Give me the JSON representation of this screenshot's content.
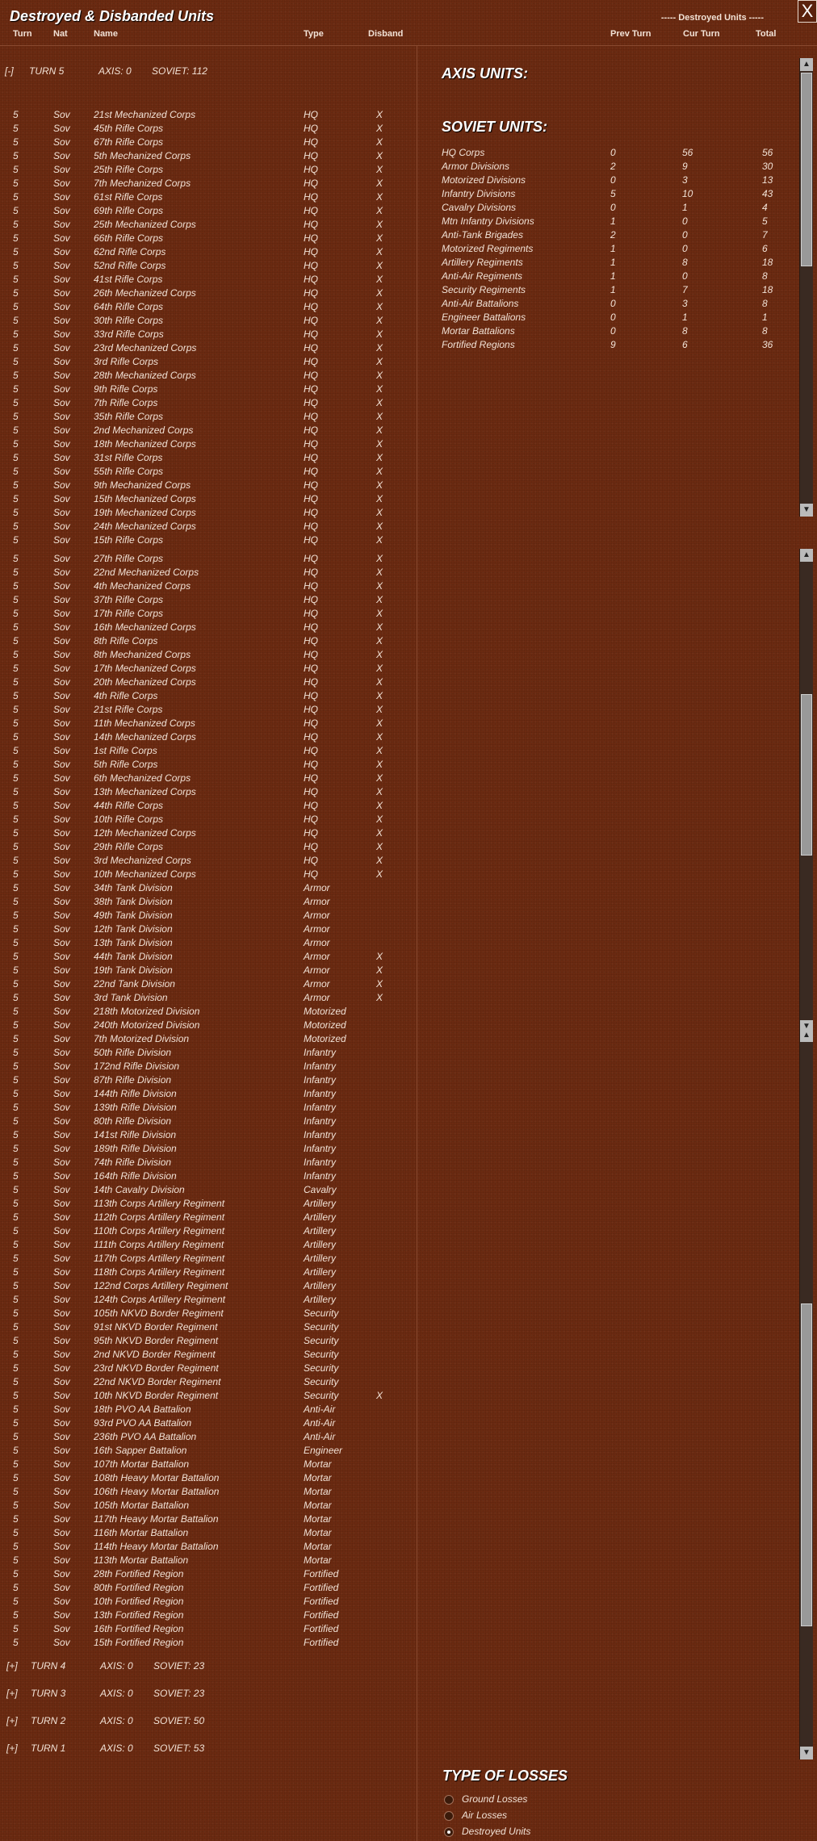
{
  "window": {
    "title": "Destroyed & Disbanded Units",
    "close": "X"
  },
  "headers": {
    "turn": "Turn",
    "nat": "Nat",
    "name": "Name",
    "type": "Type",
    "disband": "Disband",
    "destroyed_group": "----- Destroyed Units -----",
    "prev_turn": "Prev Turn",
    "cur_turn": "Cur Turn",
    "total": "Total"
  },
  "expanded_turn": {
    "toggle": "[-]",
    "label": "TURN 5",
    "axis": "AXIS: 0",
    "soviet": "SOVIET: 112"
  },
  "units": [
    [
      "5",
      "Sov",
      "21st Mechanized Corps",
      "HQ",
      "X"
    ],
    [
      "5",
      "Sov",
      "45th Rifle Corps",
      "HQ",
      "X"
    ],
    [
      "5",
      "Sov",
      "67th Rifle Corps",
      "HQ",
      "X"
    ],
    [
      "5",
      "Sov",
      "5th Mechanized Corps",
      "HQ",
      "X"
    ],
    [
      "5",
      "Sov",
      "25th Rifle Corps",
      "HQ",
      "X"
    ],
    [
      "5",
      "Sov",
      "7th Mechanized Corps",
      "HQ",
      "X"
    ],
    [
      "5",
      "Sov",
      "61st Rifle Corps",
      "HQ",
      "X"
    ],
    [
      "5",
      "Sov",
      "69th Rifle Corps",
      "HQ",
      "X"
    ],
    [
      "5",
      "Sov",
      "25th Mechanized Corps",
      "HQ",
      "X"
    ],
    [
      "5",
      "Sov",
      "66th Rifle Corps",
      "HQ",
      "X"
    ],
    [
      "5",
      "Sov",
      "62nd Rifle Corps",
      "HQ",
      "X"
    ],
    [
      "5",
      "Sov",
      "52nd Rifle Corps",
      "HQ",
      "X"
    ],
    [
      "5",
      "Sov",
      "41st Rifle Corps",
      "HQ",
      "X"
    ],
    [
      "5",
      "Sov",
      "26th Mechanized Corps",
      "HQ",
      "X"
    ],
    [
      "5",
      "Sov",
      "64th Rifle Corps",
      "HQ",
      "X"
    ],
    [
      "5",
      "Sov",
      "30th Rifle Corps",
      "HQ",
      "X"
    ],
    [
      "5",
      "Sov",
      "33rd Rifle Corps",
      "HQ",
      "X"
    ],
    [
      "5",
      "Sov",
      "23rd Mechanized Corps",
      "HQ",
      "X"
    ],
    [
      "5",
      "Sov",
      "3rd Rifle Corps",
      "HQ",
      "X"
    ],
    [
      "5",
      "Sov",
      "28th Mechanized Corps",
      "HQ",
      "X"
    ],
    [
      "5",
      "Sov",
      "9th Rifle Corps",
      "HQ",
      "X"
    ],
    [
      "5",
      "Sov",
      "7th Rifle Corps",
      "HQ",
      "X"
    ],
    [
      "5",
      "Sov",
      "35th Rifle Corps",
      "HQ",
      "X"
    ],
    [
      "5",
      "Sov",
      "2nd Mechanized Corps",
      "HQ",
      "X"
    ],
    [
      "5",
      "Sov",
      "18th Mechanized Corps",
      "HQ",
      "X"
    ],
    [
      "5",
      "Sov",
      "31st Rifle Corps",
      "HQ",
      "X"
    ],
    [
      "5",
      "Sov",
      "55th Rifle Corps",
      "HQ",
      "X"
    ],
    [
      "5",
      "Sov",
      "9th Mechanized Corps",
      "HQ",
      "X"
    ],
    [
      "5",
      "Sov",
      "15th Mechanized Corps",
      "HQ",
      "X"
    ],
    [
      "5",
      "Sov",
      "19th Mechanized Corps",
      "HQ",
      "X"
    ],
    [
      "5",
      "Sov",
      "24th Mechanized Corps",
      "HQ",
      "X"
    ],
    [
      "5",
      "Sov",
      "15th Rifle Corps",
      "HQ",
      "X"
    ],
    [
      "5",
      "Sov",
      "27th Rifle Corps",
      "HQ",
      "X"
    ],
    [
      "5",
      "Sov",
      "22nd Mechanized Corps",
      "HQ",
      "X"
    ],
    [
      "5",
      "Sov",
      "4th Mechanized Corps",
      "HQ",
      "X"
    ],
    [
      "5",
      "Sov",
      "37th Rifle Corps",
      "HQ",
      "X"
    ],
    [
      "5",
      "Sov",
      "17th Rifle Corps",
      "HQ",
      "X"
    ],
    [
      "5",
      "Sov",
      "16th Mechanized Corps",
      "HQ",
      "X"
    ],
    [
      "5",
      "Sov",
      "8th Rifle Corps",
      "HQ",
      "X"
    ],
    [
      "5",
      "Sov",
      "8th Mechanized Corps",
      "HQ",
      "X"
    ],
    [
      "5",
      "Sov",
      "17th Mechanized Corps",
      "HQ",
      "X"
    ],
    [
      "5",
      "Sov",
      "20th Mechanized Corps",
      "HQ",
      "X"
    ],
    [
      "5",
      "Sov",
      "4th Rifle Corps",
      "HQ",
      "X"
    ],
    [
      "5",
      "Sov",
      "21st Rifle Corps",
      "HQ",
      "X"
    ],
    [
      "5",
      "Sov",
      "11th Mechanized Corps",
      "HQ",
      "X"
    ],
    [
      "5",
      "Sov",
      "14th Mechanized Corps",
      "HQ",
      "X"
    ],
    [
      "5",
      "Sov",
      "1st Rifle Corps",
      "HQ",
      "X"
    ],
    [
      "5",
      "Sov",
      "5th Rifle Corps",
      "HQ",
      "X"
    ],
    [
      "5",
      "Sov",
      "6th Mechanized Corps",
      "HQ",
      "X"
    ],
    [
      "5",
      "Sov",
      "13th Mechanized Corps",
      "HQ",
      "X"
    ],
    [
      "5",
      "Sov",
      "44th Rifle Corps",
      "HQ",
      "X"
    ],
    [
      "5",
      "Sov",
      "10th Rifle Corps",
      "HQ",
      "X"
    ],
    [
      "5",
      "Sov",
      "12th Mechanized Corps",
      "HQ",
      "X"
    ],
    [
      "5",
      "Sov",
      "29th Rifle Corps",
      "HQ",
      "X"
    ],
    [
      "5",
      "Sov",
      "3rd Mechanized Corps",
      "HQ",
      "X"
    ],
    [
      "5",
      "Sov",
      "10th Mechanized Corps",
      "HQ",
      "X"
    ],
    [
      "5",
      "Sov",
      "34th Tank Division",
      "Armor",
      ""
    ],
    [
      "5",
      "Sov",
      "38th Tank Division",
      "Armor",
      ""
    ],
    [
      "5",
      "Sov",
      "49th Tank Division",
      "Armor",
      ""
    ],
    [
      "5",
      "Sov",
      "12th Tank Division",
      "Armor",
      ""
    ],
    [
      "5",
      "Sov",
      "13th Tank Division",
      "Armor",
      ""
    ],
    [
      "5",
      "Sov",
      "44th Tank Division",
      "Armor",
      "X"
    ],
    [
      "5",
      "Sov",
      "19th Tank Division",
      "Armor",
      "X"
    ],
    [
      "5",
      "Sov",
      "22nd Tank Division",
      "Armor",
      "X"
    ],
    [
      "5",
      "Sov",
      "3rd Tank Division",
      "Armor",
      "X"
    ],
    [
      "5",
      "Sov",
      "218th Motorized Division",
      "Motorized",
      ""
    ],
    [
      "5",
      "Sov",
      "240th Motorized Division",
      "Motorized",
      ""
    ],
    [
      "5",
      "Sov",
      "7th Motorized Division",
      "Motorized",
      ""
    ],
    [
      "5",
      "Sov",
      "50th Rifle Division",
      "Infantry",
      ""
    ],
    [
      "5",
      "Sov",
      "172nd Rifle Division",
      "Infantry",
      ""
    ],
    [
      "5",
      "Sov",
      "87th Rifle Division",
      "Infantry",
      ""
    ],
    [
      "5",
      "Sov",
      "144th Rifle Division",
      "Infantry",
      ""
    ],
    [
      "5",
      "Sov",
      "139th Rifle Division",
      "Infantry",
      ""
    ],
    [
      "5",
      "Sov",
      "80th Rifle Division",
      "Infantry",
      ""
    ],
    [
      "5",
      "Sov",
      "141st Rifle Division",
      "Infantry",
      ""
    ],
    [
      "5",
      "Sov",
      "189th Rifle Division",
      "Infantry",
      ""
    ],
    [
      "5",
      "Sov",
      "74th Rifle Division",
      "Infantry",
      ""
    ],
    [
      "5",
      "Sov",
      "164th Rifle Division",
      "Infantry",
      ""
    ],
    [
      "5",
      "Sov",
      "14th Cavalry Division",
      "Cavalry",
      ""
    ],
    [
      "5",
      "Sov",
      "113th Corps Artillery Regiment",
      "Artillery",
      ""
    ],
    [
      "5",
      "Sov",
      "112th Corps Artillery Regiment",
      "Artillery",
      ""
    ],
    [
      "5",
      "Sov",
      "110th Corps Artillery Regiment",
      "Artillery",
      ""
    ],
    [
      "5",
      "Sov",
      "111th Corps Artillery Regiment",
      "Artillery",
      ""
    ],
    [
      "5",
      "Sov",
      "117th Corps Artillery Regiment",
      "Artillery",
      ""
    ],
    [
      "5",
      "Sov",
      "118th Corps Artillery Regiment",
      "Artillery",
      ""
    ],
    [
      "5",
      "Sov",
      "122nd Corps Artillery Regiment",
      "Artillery",
      ""
    ],
    [
      "5",
      "Sov",
      "124th Corps Artillery Regiment",
      "Artillery",
      ""
    ],
    [
      "5",
      "Sov",
      "105th NKVD Border Regiment",
      "Security",
      ""
    ],
    [
      "5",
      "Sov",
      "91st NKVD Border Regiment",
      "Security",
      ""
    ],
    [
      "5",
      "Sov",
      "95th NKVD Border Regiment",
      "Security",
      ""
    ],
    [
      "5",
      "Sov",
      "2nd NKVD Border Regiment",
      "Security",
      ""
    ],
    [
      "5",
      "Sov",
      "23rd NKVD Border Regiment",
      "Security",
      ""
    ],
    [
      "5",
      "Sov",
      "22nd NKVD Border Regiment",
      "Security",
      ""
    ],
    [
      "5",
      "Sov",
      "10th NKVD Border Regiment",
      "Security",
      "X"
    ],
    [
      "5",
      "Sov",
      "18th PVO AA Battalion",
      "Anti-Air",
      ""
    ],
    [
      "5",
      "Sov",
      "93rd PVO AA Battalion",
      "Anti-Air",
      ""
    ],
    [
      "5",
      "Sov",
      "236th PVO AA Battalion",
      "Anti-Air",
      ""
    ],
    [
      "5",
      "Sov",
      "16th Sapper Battalion",
      "Engineer",
      ""
    ],
    [
      "5",
      "Sov",
      "107th Mortar Battalion",
      "Mortar",
      ""
    ],
    [
      "5",
      "Sov",
      "108th Heavy Mortar Battalion",
      "Mortar",
      ""
    ],
    [
      "5",
      "Sov",
      "106th Heavy Mortar Battalion",
      "Mortar",
      ""
    ],
    [
      "5",
      "Sov",
      "105th Mortar Battalion",
      "Mortar",
      ""
    ],
    [
      "5",
      "Sov",
      "117th Heavy Mortar Battalion",
      "Mortar",
      ""
    ],
    [
      "5",
      "Sov",
      "116th Mortar Battalion",
      "Mortar",
      ""
    ],
    [
      "5",
      "Sov",
      "114th Heavy Mortar Battalion",
      "Mortar",
      ""
    ],
    [
      "5",
      "Sov",
      "113th Mortar Battalion",
      "Mortar",
      ""
    ],
    [
      "5",
      "Sov",
      "28th Fortified Region",
      "Fortified",
      ""
    ],
    [
      "5",
      "Sov",
      "80th Fortified Region",
      "Fortified",
      ""
    ],
    [
      "5",
      "Sov",
      "10th Fortified Region",
      "Fortified",
      ""
    ],
    [
      "5",
      "Sov",
      "13th Fortified Region",
      "Fortified",
      ""
    ],
    [
      "5",
      "Sov",
      "16th Fortified Region",
      "Fortified",
      ""
    ],
    [
      "5",
      "Sov",
      "15th Fortified Region",
      "Fortified",
      ""
    ]
  ],
  "collapsed_turns": [
    {
      "toggle": "[+]",
      "label": "TURN 4",
      "axis": "AXIS: 0",
      "soviet": "SOVIET: 23"
    },
    {
      "toggle": "[+]",
      "label": "TURN 3",
      "axis": "AXIS: 0",
      "soviet": "SOVIET: 23"
    },
    {
      "toggle": "[+]",
      "label": "TURN 2",
      "axis": "AXIS: 0",
      "soviet": "SOVIET: 50"
    },
    {
      "toggle": "[+]",
      "label": "TURN 1",
      "axis": "AXIS: 0",
      "soviet": "SOVIET: 53"
    }
  ],
  "summary": {
    "axis_title": "AXIS UNITS:",
    "soviet_title": "SOVIET UNITS:",
    "rows": [
      [
        "HQ Corps",
        "0",
        "56",
        "56"
      ],
      [
        "Armor Divisions",
        "2",
        "9",
        "30"
      ],
      [
        "Motorized Divisions",
        "0",
        "3",
        "13"
      ],
      [
        "Infantry Divisions",
        "5",
        "10",
        "43"
      ],
      [
        "Cavalry Divisions",
        "0",
        "1",
        "4"
      ],
      [
        "Mtn Infantry Divisions",
        "1",
        "0",
        "5"
      ],
      [
        "Anti-Tank Brigades",
        "2",
        "0",
        "7"
      ],
      [
        "Motorized Regiments",
        "1",
        "0",
        "6"
      ],
      [
        "Artillery Regiments",
        "1",
        "8",
        "18"
      ],
      [
        "Anti-Air Regiments",
        "1",
        "0",
        "8"
      ],
      [
        "Security Regiments",
        "1",
        "7",
        "18"
      ],
      [
        "Anti-Air Battalions",
        "0",
        "3",
        "8"
      ],
      [
        "Engineer Battalions",
        "0",
        "1",
        "1"
      ],
      [
        "Mortar Battalions",
        "0",
        "8",
        "8"
      ],
      [
        "Fortified Regions",
        "9",
        "6",
        "36"
      ]
    ]
  },
  "losses": {
    "title": "TYPE OF LOSSES",
    "options": [
      {
        "label": "Ground Losses",
        "selected": false
      },
      {
        "label": "Air Losses",
        "selected": false
      },
      {
        "label": "Destroyed Units",
        "selected": true
      }
    ]
  },
  "scroll_arrows": {
    "up": "▲",
    "down": "▼"
  }
}
